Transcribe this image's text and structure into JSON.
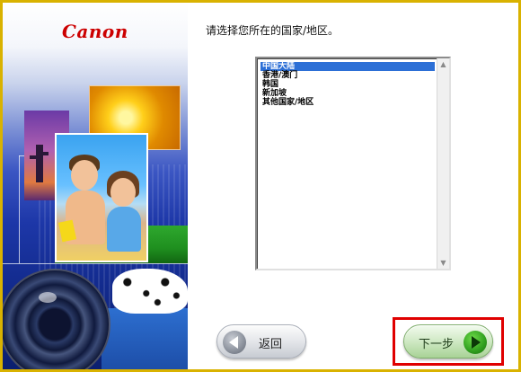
{
  "brand": {
    "logo_text": "Canon",
    "logo_color": "#cc0000"
  },
  "prompt": "请选择您所在的国家/地区。",
  "country_list": {
    "items": [
      "中国大陆",
      "香港/澳门",
      "韩国",
      "新加坡",
      "其他国家/地区"
    ],
    "selected_index": 0,
    "selected_value": "中国大陆"
  },
  "navigation": {
    "back_label": "返回",
    "next_label": "下一步"
  },
  "colors": {
    "selection": "#2c6fd6",
    "frame_border": "#d9b200",
    "highlight_box": "#e00000",
    "next_button_green": "#2f9e1e"
  },
  "icons": [
    "left-arrow-icon",
    "right-arrow-icon",
    "scroll-up-arrow-icon",
    "scroll-down-arrow-icon"
  ]
}
